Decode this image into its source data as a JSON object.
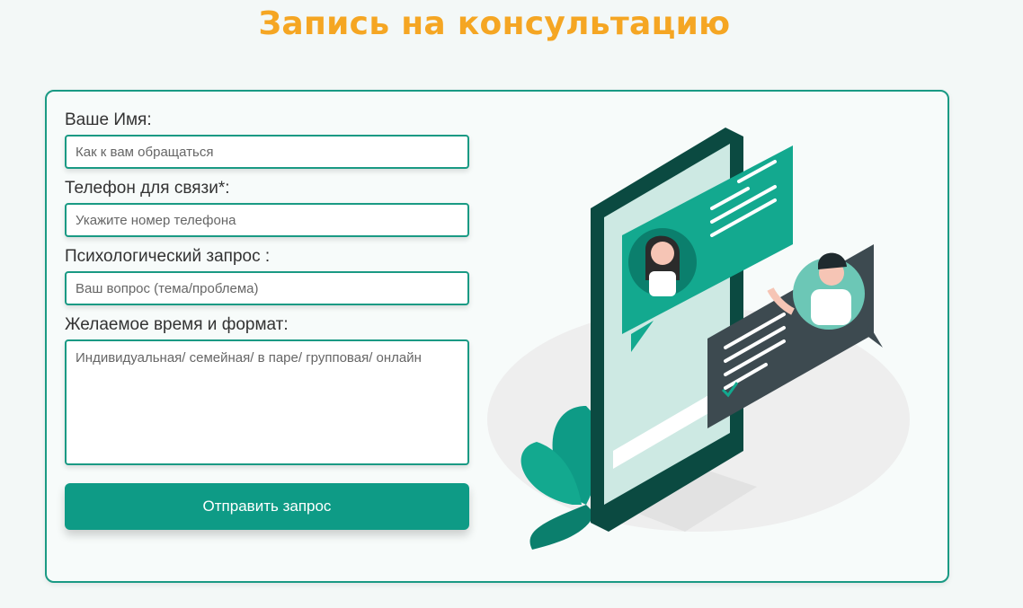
{
  "page": {
    "title": "Запись на консультацию"
  },
  "form": {
    "name_label": "Ваше Имя:",
    "name_placeholder": "Как к вам обращаться",
    "phone_label": "Телефон для связи*:",
    "phone_placeholder": "Укажите номер телефона",
    "request_label": "Психологический запрос :",
    "request_placeholder": "Ваш вопрос (тема/проблема)",
    "time_label": "Желаемое время и формат:",
    "time_placeholder": "Индивидуальная/ семейная/ в паре/ групповая/ онлайн",
    "submit_label": "Отправить запрос"
  },
  "colors": {
    "accent": "#0e9b86",
    "title": "#f5a623",
    "dark_green": "#0b4a41"
  }
}
